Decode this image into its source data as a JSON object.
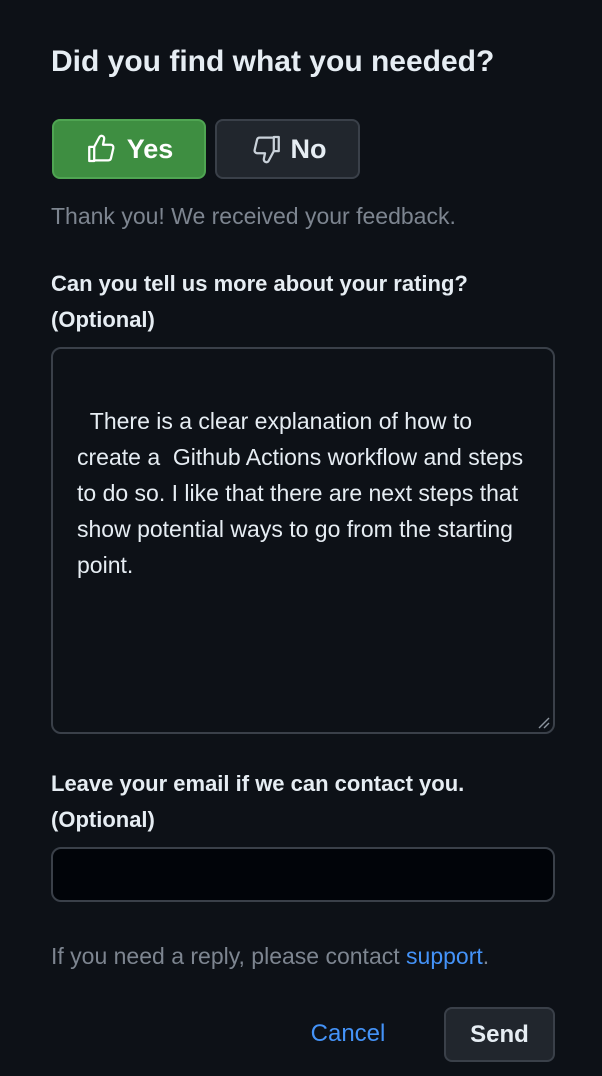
{
  "feedback": {
    "title": "Did you find what you needed?",
    "yes_label": "Yes",
    "no_label": "No",
    "thanks_message": "Thank you! We received your feedback.",
    "rating_label_line1": "Can you tell us more about your rating?",
    "rating_label_line2": "(Optional)",
    "rating_text": "There is a clear explanation of how to create a  Github Actions workflow and steps to do so. I like that there are next steps that show potential ways to go from the starting point.",
    "email_label_line1": "Leave your email if we can contact you.",
    "email_label_line2": "(Optional)",
    "email_value": "",
    "reply_note_prefix": "If you need a reply, please contact ",
    "support_link": "support",
    "reply_note_suffix": ".",
    "cancel_label": "Cancel",
    "send_label": "Send"
  },
  "icons": {
    "yes": "thumbs-up-icon",
    "no": "thumbs-down-icon"
  },
  "colors": {
    "background": "#0d1117",
    "yes_button": "#3e8e41",
    "link": "#4493f8",
    "muted_text": "#7d8590"
  }
}
